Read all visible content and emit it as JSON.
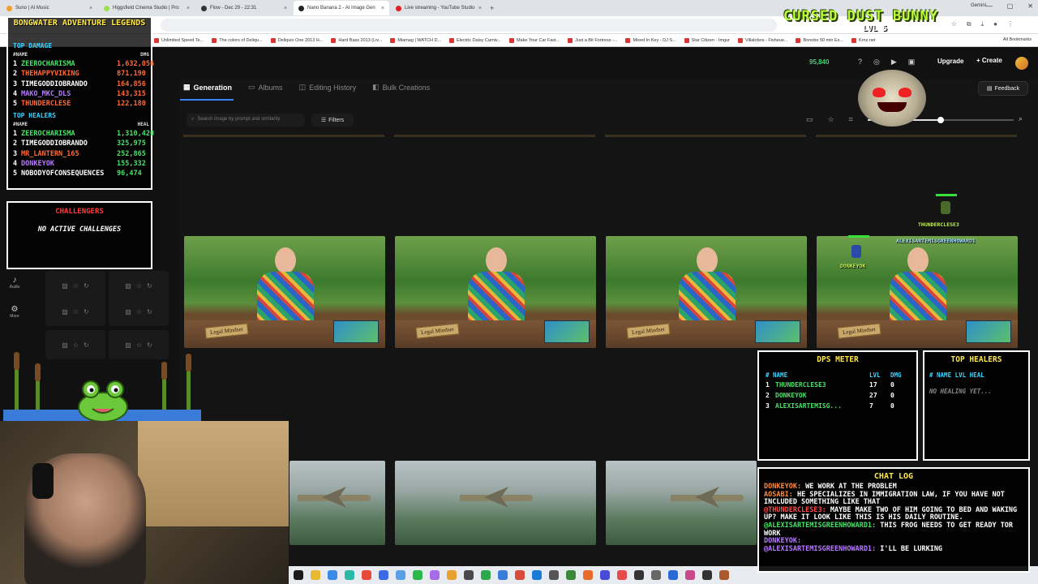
{
  "browser": {
    "tabs": [
      {
        "label": "Suno | AI Music",
        "color": "#f0a030",
        "active": false
      },
      {
        "label": "Higgsfield Cinema Studio | Pro",
        "color": "#9ae050",
        "active": false
      },
      {
        "label": "Flow - Dec 29 - 22:31",
        "color": "#333333",
        "active": false
      },
      {
        "label": "Nano Banana 2 - AI Image Gen",
        "color": "#222222",
        "active": true
      },
      {
        "label": "Live streaming - YouTube Studio",
        "color": "#e02020",
        "active": false
      }
    ],
    "new_tab": "+",
    "gemini": "Gemini",
    "url": "",
    "bookmarks": [
      "Unlimited Speed Te...",
      "The colors of Deliqu...",
      "Deliquio One 2013 H...",
      "Hard Bass 2013 (Liv...",
      "Miamag | WATCH D...",
      "Electric Daisy Carniv...",
      "Make Your Car Fast...",
      "Just a Bit Fortress -...",
      "Mixed In Key - DJ S...",
      "Star Citizen - Imgur",
      "Villalobos - Fisheue...",
      "Bonobo 50 min Ex...",
      "Krnz.net"
    ],
    "all_bookmarks": "All Bookmarks"
  },
  "app": {
    "credits": "95,840",
    "upgrade": "Upgrade",
    "create": "Create",
    "tabs": [
      "Generation",
      "Albums",
      "Editing History",
      "Bulk Creations"
    ],
    "feedback": "Feedback",
    "search_placeholder": "Search image by prompt and similarity",
    "filters": "Filters",
    "zoom": 0.5,
    "side_nav": [
      {
        "label": "Audio",
        "icon": "♪"
      },
      {
        "label": "More",
        "icon": "⚙"
      }
    ],
    "image_plates": [
      "Legal Mindset",
      "Legal Mindset",
      "Legal Mindset",
      "Legal Mindset"
    ]
  },
  "overlay": {
    "title": "BONGWATER ADVENTURE LEGENDS",
    "top_damage_header": "TOP DAMAGE",
    "name_col": "#NAME",
    "dmg_col": "DMG",
    "damage": [
      {
        "rank": "1",
        "name": "ZEEROCHARISMA",
        "value": "1,632,056",
        "color": "#4ae06a"
      },
      {
        "rank": "2",
        "name": "THEHAPPYVIKING",
        "value": "871,190",
        "color": "#ff6a3a"
      },
      {
        "rank": "3",
        "name": "TIMEGODDIOBRANDO",
        "value": "164,856",
        "color": "#ffffff"
      },
      {
        "rank": "4",
        "name": "MAKO_MKC_DLS",
        "value": "143,315",
        "color": "#b87aff"
      },
      {
        "rank": "5",
        "name": "THUNDERCLESE",
        "value": "122,180",
        "color": "#ff6a3a"
      }
    ],
    "top_healers_header": "TOP HEALERS",
    "heal_col": "HEAL",
    "healers": [
      {
        "rank": "1",
        "name": "ZEEROCHARISMA",
        "value": "1,310,420",
        "color": "#4ae06a"
      },
      {
        "rank": "2",
        "name": "TIMEGODDIOBRANDO",
        "value": "325,975",
        "color": "#ffffff"
      },
      {
        "rank": "3",
        "name": "MR_LANTERN_165",
        "value": "252,865",
        "color": "#ff6a3a"
      },
      {
        "rank": "4",
        "name": "DONKEYOK",
        "value": "155,332",
        "color": "#b87aff"
      },
      {
        "rank": "5",
        "name": "NOBODYOFCONSEQUENCES",
        "value": "96,474",
        "color": "#ffffff"
      }
    ],
    "challengers_title": "CHALLENGERS",
    "challengers_msg": "NO ACTIVE CHALLENGES",
    "streamer_name": "CURSED DUST BUNNY",
    "streamer_lvl": "LVL 5",
    "players": [
      {
        "name": "THUNDERCLESE3"
      },
      {
        "name": "ALEXISARTEMISGREENHOWARD1"
      },
      {
        "name": "DONKEYOK"
      }
    ],
    "dps_title": "DPS METER",
    "dps_cols": [
      "# NAME",
      "LVL",
      "DMG"
    ],
    "dps": [
      {
        "rank": "1",
        "name": "THUNDERCLESE3",
        "lvl": "17",
        "dmg": "0"
      },
      {
        "rank": "2",
        "name": "DONKEYOK",
        "lvl": "27",
        "dmg": "0"
      },
      {
        "rank": "3",
        "name": "ALEXISARTEMISG...",
        "lvl": "7",
        "dmg": "0"
      }
    ],
    "healers_title": "TOP HEALERS",
    "healers_cols": "# NAME  LVL  HEAL",
    "healers_msg": "NO HEALING YET...",
    "chat_title": "CHAT LOG",
    "chat": [
      {
        "user": "DONKEYOK:",
        "text": " WE WORK AT THE PROBLEM",
        "color": "#ff8a3a"
      },
      {
        "user": "AOSABI:",
        "text": " HE SPECIALIZES IN IMMIGRATION LAW, IF YOU HAVE NOT INCLUDED SOMETHING LIKE THAT",
        "color": "#ff8a3a"
      },
      {
        "user": "@THUNDERCLESE3:",
        "text": " MAYBE MAKE TWO OF HIM GOING TO BED AND WAKING UP? MAKE IT LOOK LIKE THIS IS HIS DAILY ROUTINE.",
        "color": "#ff4a4a"
      },
      {
        "user": "@ALEXISARTEMISGREENHOWARD1:",
        "text": " THIS FROG NEEDS TO GET READY TOR WORK",
        "color": "#4ae06a"
      },
      {
        "user": "DONKEYOK:",
        "text": "",
        "color": "#b87aff"
      },
      {
        "user": "@ALEXISARTEMISGREENHOWARD1:",
        "text": " I'LL BE LURKING",
        "color": "#b87aff"
      }
    ]
  }
}
